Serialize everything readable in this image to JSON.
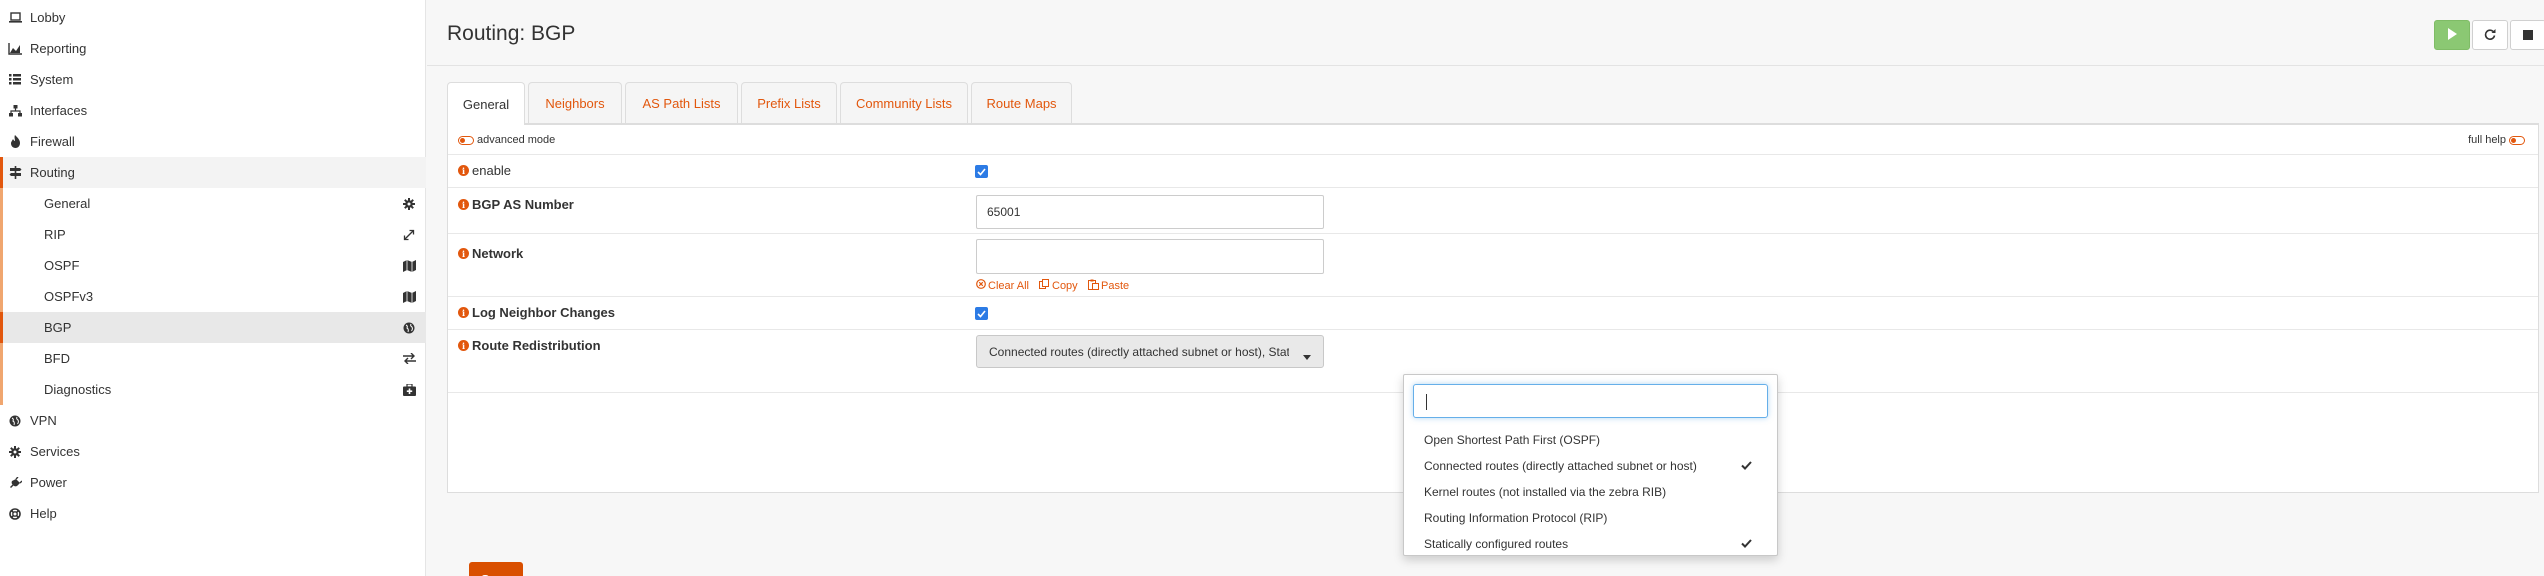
{
  "sidebar": {
    "items": [
      {
        "label": "Lobby",
        "icon": "laptop-icon"
      },
      {
        "label": "Reporting",
        "icon": "area-chart-icon"
      },
      {
        "label": "System",
        "icon": "list-icon"
      },
      {
        "label": "Interfaces",
        "icon": "sitemap-icon"
      },
      {
        "label": "Firewall",
        "icon": "fire-icon"
      },
      {
        "label": "Routing",
        "icon": "signpost-icon"
      },
      {
        "label": "VPN",
        "icon": "globe-icon"
      },
      {
        "label": "Services",
        "icon": "gear-icon"
      },
      {
        "label": "Power",
        "icon": "plug-icon"
      },
      {
        "label": "Help",
        "icon": "lifebuoy-icon"
      }
    ],
    "routing_sub": [
      {
        "label": "General",
        "icon": "gear-icon"
      },
      {
        "label": "RIP",
        "icon": "expand-arrows-icon"
      },
      {
        "label": "OSPF",
        "icon": "map-icon"
      },
      {
        "label": "OSPFv3",
        "icon": "map-icon"
      },
      {
        "label": "BGP",
        "icon": "globe-icon"
      },
      {
        "label": "BFD",
        "icon": "exchange-icon"
      },
      {
        "label": "Diagnostics",
        "icon": "medkit-icon"
      }
    ]
  },
  "header": {
    "title": "Routing: BGP"
  },
  "tabs": [
    "General",
    "Neighbors",
    "AS Path Lists",
    "Prefix Lists",
    "Community Lists",
    "Route Maps"
  ],
  "form": {
    "advanced_mode": "advanced mode",
    "full_help": "full help",
    "enable_label": "enable",
    "as_label": "BGP AS Number",
    "as_value": "65001",
    "network_label": "Network",
    "clear_all": "Clear All",
    "copy": "Copy",
    "paste": "Paste",
    "log_label": "Log Neighbor Changes",
    "redistribution_label": "Route Redistribution",
    "redistribution_selected": "Connected routes (directly attached subnet or host), Statically configured routes",
    "save_label": "Save"
  },
  "dropdown": {
    "options": [
      {
        "label": "Open Shortest Path First (OSPF)",
        "checked": false
      },
      {
        "label": "Connected routes (directly attached subnet or host)",
        "checked": true
      },
      {
        "label": "Kernel routes (not installed via the zebra RIB)",
        "checked": false
      },
      {
        "label": "Routing Information Protocol (RIP)",
        "checked": false
      },
      {
        "label": "Statically configured routes",
        "checked": true
      }
    ]
  },
  "colors": {
    "accent": "#e2570d",
    "checkbox": "#2c7be5",
    "play": "#8bc873"
  }
}
